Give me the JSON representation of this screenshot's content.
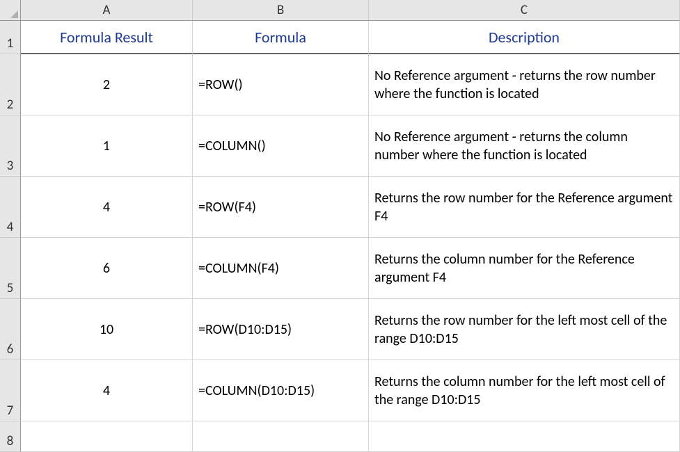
{
  "columns": [
    "A",
    "B",
    "C"
  ],
  "rowNumbers": [
    "1",
    "2",
    "3",
    "4",
    "5",
    "6",
    "7",
    "8"
  ],
  "headers": {
    "A": "Formula Result",
    "B": "Formula",
    "C": "Description"
  },
  "rows": [
    {
      "result": "2",
      "formula": "=ROW()",
      "description": "No Reference argument - returns the row number where the function is located"
    },
    {
      "result": "1",
      "formula": "=COLUMN()",
      "description": "No Reference argument - returns the column number where the function is located"
    },
    {
      "result": "4",
      "formula": "=ROW(F4)",
      "description": "Returns the row number for the Reference argument F4"
    },
    {
      "result": "6",
      "formula": "=COLUMN(F4)",
      "description": "Returns the column number for the Reference argument F4"
    },
    {
      "result": "10",
      "formula": "=ROW(D10:D15)",
      "description": "Returns the row number for the left most cell of the range D10:D15"
    },
    {
      "result": "4",
      "formula": "=COLUMN(D10:D15)",
      "description": "Returns the column number for the left most cell of the range D10:D15"
    }
  ]
}
